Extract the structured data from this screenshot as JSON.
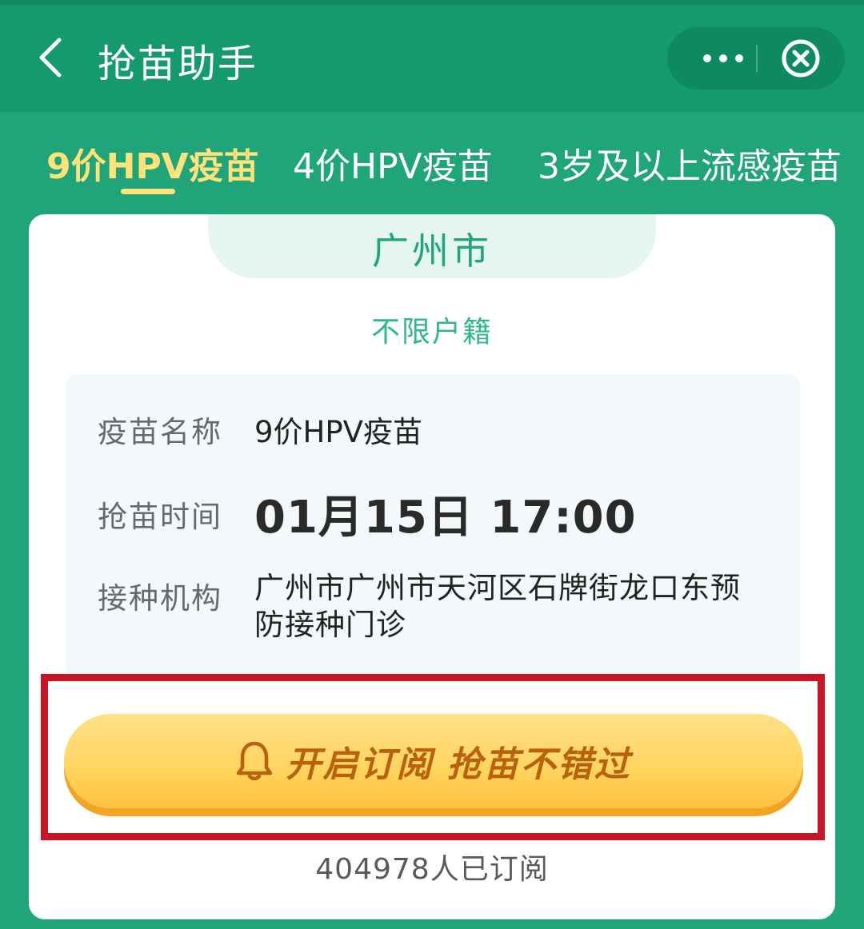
{
  "header": {
    "title": "抢苗助手"
  },
  "tabs": [
    {
      "label": "9价HPV疫苗",
      "active": true
    },
    {
      "label": "4价HPV疫苗",
      "active": false
    },
    {
      "label": "3岁及以上流感疫苗",
      "active": false
    }
  ],
  "card": {
    "city": "广州市",
    "hukou": "不限户籍",
    "vaccine_label": "疫苗名称",
    "vaccine_value": "9价HPV疫苗",
    "time_label": "抢苗时间",
    "time_value": "01月15日 17:00",
    "org_label": "接种机构",
    "org_value": "广州市广州市天河区石牌街龙口东预防接种门诊"
  },
  "subscribe": {
    "button_label": "开启订阅 抢苗不错过",
    "count_text": "404978人已订阅"
  },
  "colors": {
    "header_green": "#159a6d",
    "tab_green": "#1fa579",
    "active_tab": "#ffe27a",
    "highlight_red": "#c81424",
    "button_yellow": "#ffd45e"
  }
}
